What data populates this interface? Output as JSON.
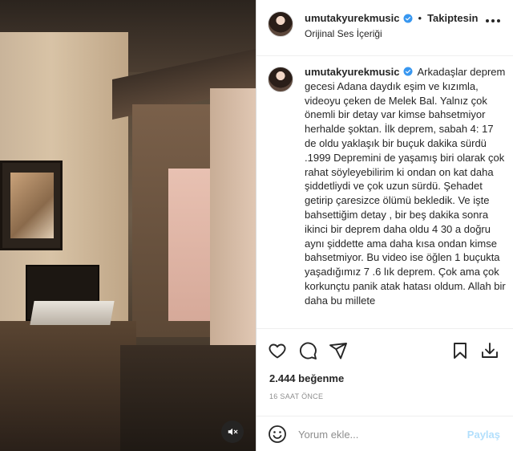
{
  "post": {
    "username": "umutakyurekmusic",
    "follow_state": "Takiptesin",
    "separator": "•",
    "audio_label": "Orijinal Ses İçeriği",
    "caption": "Arkadaşlar deprem gecesi Adana daydık eşim ve kızımla, videoyu çeken de Melek Bal. Yalnız çok önemli bir detay var kimse bahsetmiyor herhalde şoktan. İlk deprem, sabah 4: 17 de oldu yaklaşık bir buçuk dakika sürdü .1999 Depremini de yaşamış biri olarak çok rahat söyleyebilirim ki ondan on kat daha şiddetliydi ve çok uzun sürdü. Şehadet getirip çaresizce ölümü bekledik. Ve işte bahsettiğim detay , bir beş dakika sonra ikinci bir deprem daha oldu 4 30 a doğru aynı şiddette ama daha kısa ondan kimse bahsetmiyor. Bu video ise öğlen 1 buçukta yaşadığımız 7 .6 lık deprem. Çok ama çok korkunçtu panik atak hatası oldum. Allah bir daha bu millete",
    "likes": "2.444 beğenme",
    "timestamp": "16 SAAT ÖNCE"
  },
  "comment": {
    "placeholder": "Yorum ekle...",
    "post_label": "Paylaş"
  },
  "icons": {
    "verified": "verified-badge-icon",
    "more": "more-options-icon",
    "like": "heart-icon",
    "comment": "comment-icon",
    "share": "send-icon",
    "save": "bookmark-icon",
    "download": "download-icon",
    "mute": "speaker-muted-icon",
    "emoji": "emoji-icon"
  },
  "colors": {
    "verified": "#3897f0",
    "text": "#262626",
    "muted_text": "#8e8e8e",
    "post_button_disabled": "#b2dffc",
    "border": "#efefef"
  }
}
